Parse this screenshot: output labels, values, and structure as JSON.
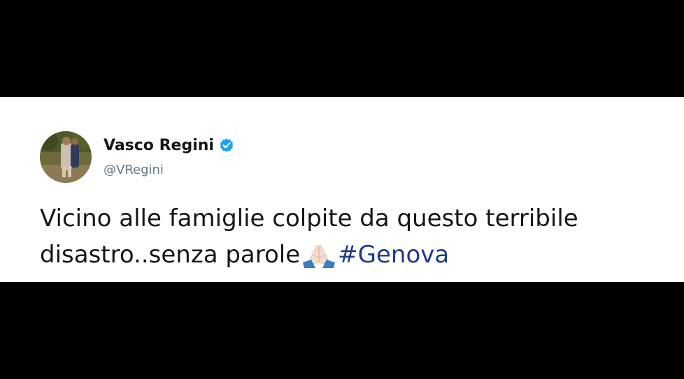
{
  "tweet": {
    "author": {
      "display_name": "Vasco Regini",
      "handle": "@VRegini",
      "verified": true
    },
    "text_line1": "Vicino alle famiglie colpite da questo terribile",
    "text_line2": "disastro..senza parole",
    "emoji": "folded-hands",
    "hashtag": "#Genova"
  },
  "colors": {
    "background": "#000000",
    "card": "#ffffff",
    "text": "#14171a",
    "handle": "#657786",
    "hashtag": "#1b3a8c",
    "verified": "#1da1f2"
  }
}
